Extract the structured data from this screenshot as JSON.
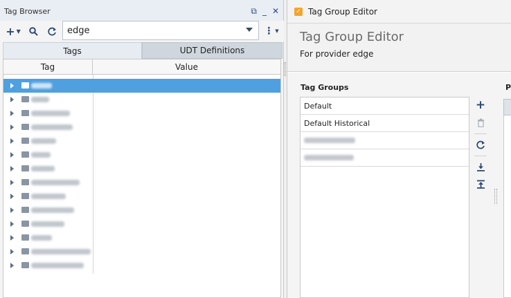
{
  "tag_browser": {
    "title": "Tag Browser",
    "toolbar": {
      "add_label": "+",
      "provider_value": "edge"
    },
    "tabs": [
      {
        "label": "Tags",
        "active": true
      },
      {
        "label": "UDT Definitions",
        "active": false
      }
    ],
    "columns": {
      "tag": "Tag",
      "value": "Value"
    },
    "row_count": 14,
    "selected_row": 0
  },
  "tag_group_editor": {
    "title": "Tag Group Editor",
    "heading": "Tag Group Editor",
    "subheading": "For provider edge",
    "tag_groups_label": "Tag Groups",
    "groups": [
      "Default",
      "Default Historical"
    ],
    "properties_label_partial": "Pr"
  },
  "colors": {
    "selection": "#4ea0e0",
    "accent_icon": "#2d4a7a",
    "editor_icon": "#f3a52b"
  },
  "icons": {
    "dock": "dock-icon",
    "minimize": "minimize-icon",
    "close": "close-icon",
    "add": "plus-icon",
    "search": "search-icon",
    "refresh": "refresh-icon",
    "menu": "kebab-menu-icon",
    "delete": "trash-icon",
    "import": "import-icon",
    "export": "export-icon"
  }
}
